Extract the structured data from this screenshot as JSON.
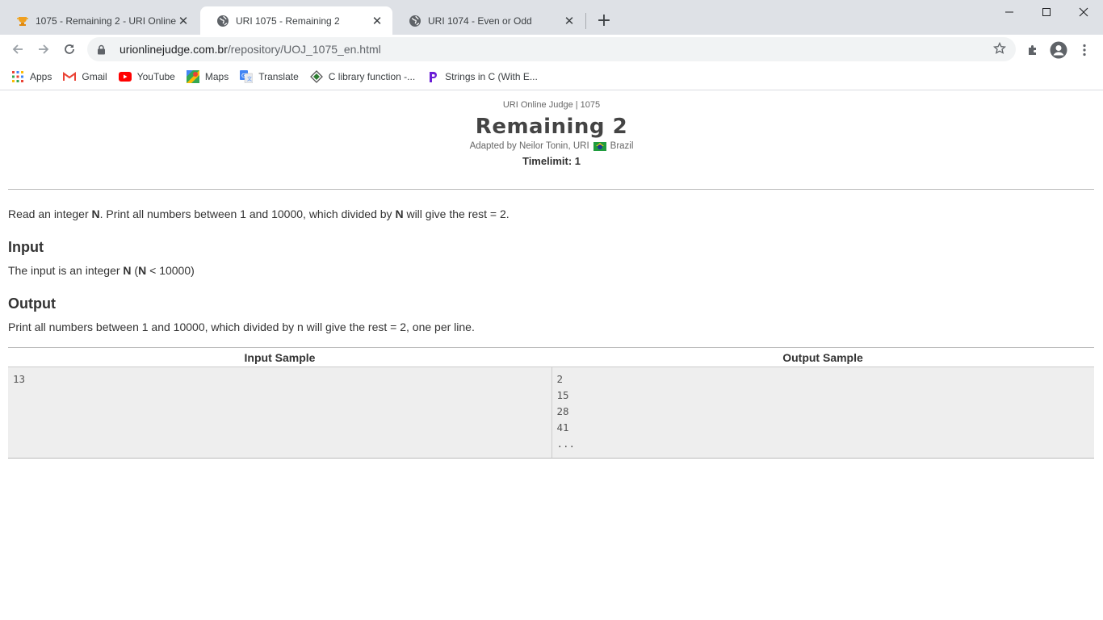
{
  "browser": {
    "tabs": [
      {
        "title": "1075 - Remaining 2 - URI Online",
        "favicon": "uri-trophy-icon",
        "active": false
      },
      {
        "title": "URI 1075 - Remaining 2",
        "favicon": "globe-icon",
        "active": true
      },
      {
        "title": "URI 1074 - Even or Odd",
        "favicon": "globe-icon",
        "active": false
      }
    ],
    "close_glyph": "✕",
    "new_tab_glyph": "+",
    "url_host": "urionlinejudge.com.br",
    "url_path": "/repository/UOJ_1075_en.html",
    "bookmarks": [
      {
        "label": "Apps",
        "icon": "apps-grid-icon"
      },
      {
        "label": "Gmail",
        "icon": "gmail-icon"
      },
      {
        "label": "YouTube",
        "icon": "youtube-icon"
      },
      {
        "label": "Maps",
        "icon": "maps-icon"
      },
      {
        "label": "Translate",
        "icon": "translate-icon"
      },
      {
        "label": "C library function -...",
        "icon": "c-library-icon"
      },
      {
        "label": "Strings in C (With E...",
        "icon": "programiz-icon"
      }
    ]
  },
  "page": {
    "breadcrumb": "URI Online Judge | 1075",
    "title": "Remaining 2",
    "author_prefix": "Adapted by Neilor Tonin, URI",
    "author_country": "Brazil",
    "timelimit": "Timelimit: 1",
    "description": {
      "part1": "Read an integer ",
      "n1": "N",
      "part2": ". Print all numbers between 1 and 10000, which divided by ",
      "n2": "N",
      "part3": " will give the rest = 2."
    },
    "input_heading": "Input",
    "input_text": {
      "part1": "The input is an integer ",
      "n1": "N",
      "part2": " (",
      "n2": "N",
      "part3": " < 10000)"
    },
    "output_heading": "Output",
    "output_text": "Print all numbers between 1 and 10000, which divided by n will give the rest = 2, one per line.",
    "samples": {
      "input_header": "Input Sample",
      "output_header": "Output Sample",
      "input_lines": [
        "13"
      ],
      "output_lines": [
        "2",
        "15",
        "28",
        "41",
        "..."
      ]
    }
  }
}
